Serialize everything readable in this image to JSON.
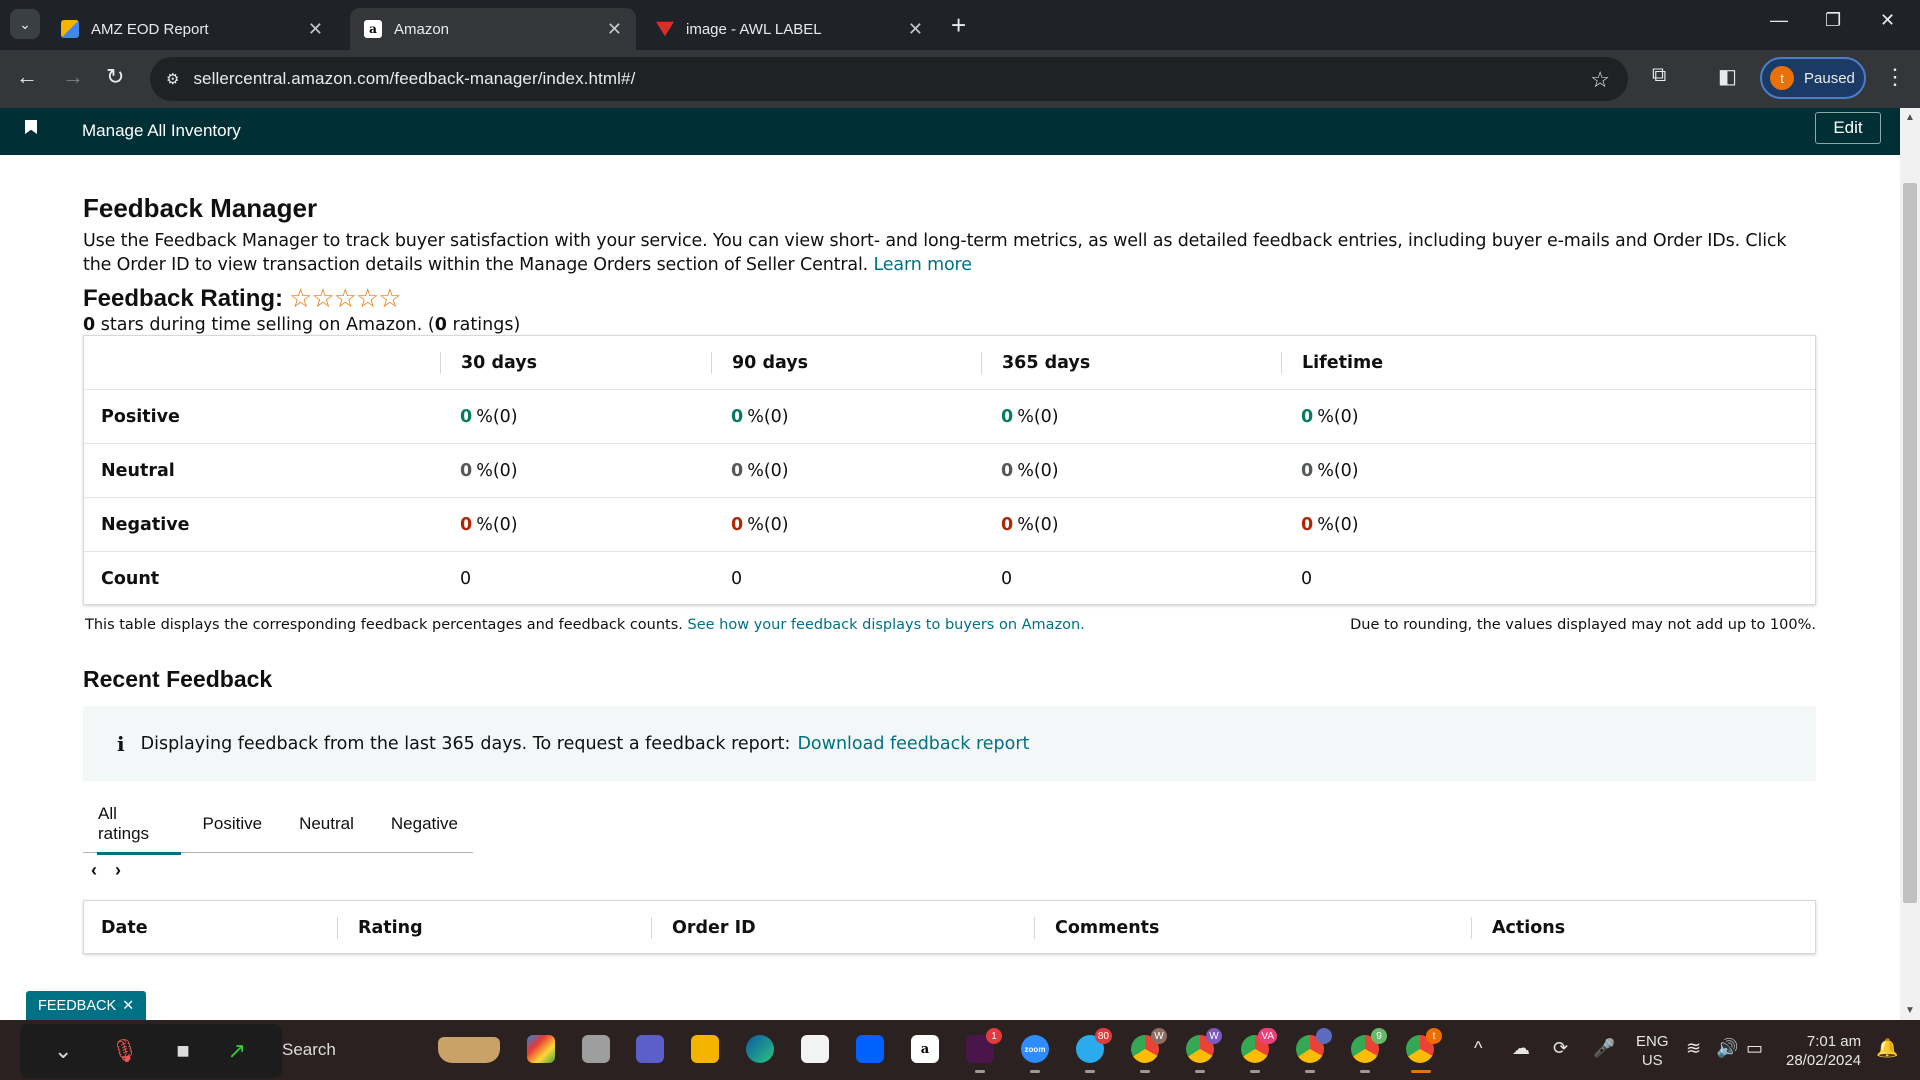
{
  "browser": {
    "tabs": [
      {
        "title": "AMZ EOD Report",
        "icon": "google-apps-script-icon",
        "active": false
      },
      {
        "title": "Amazon",
        "icon": "amazon-icon",
        "active": true
      },
      {
        "title": "image - AWL LABEL",
        "icon": "label-tag-icon",
        "active": false
      }
    ],
    "url": "sellercentral.amazon.com/feedback-manager/index.html#/",
    "profile_label": "Paused",
    "profile_initial": "t"
  },
  "seller_nav": {
    "bookmark_link": "Manage All Inventory",
    "edit_label": "Edit"
  },
  "page": {
    "title": "Feedback Manager",
    "description": "Use the Feedback Manager to track buyer satisfaction with your service. You can view short- and long-term metrics, as well as detailed feedback entries, including buyer e-mails and Order IDs. Click the Order ID to view transaction details within the Manage Orders section of Seller Central.",
    "learn_more": "Learn more",
    "rating_heading": "Feedback Rating:",
    "stars": "☆☆☆☆☆",
    "rating_stars_value": "0",
    "rating_sub_mid": " stars during time selling on Amazon. (",
    "rating_count_value": "0",
    "rating_sub_end": " ratings)"
  },
  "metrics": {
    "columns": [
      "30 days",
      "90 days",
      "365 days",
      "Lifetime"
    ],
    "rows": [
      {
        "label": "Positive",
        "values": [
          {
            "n": "0",
            "suffix": " %(0)"
          },
          {
            "n": "0",
            "suffix": " %(0)"
          },
          {
            "n": "0",
            "suffix": " %(0)"
          },
          {
            "n": "0",
            "suffix": " %(0)"
          }
        ]
      },
      {
        "label": "Neutral",
        "values": [
          {
            "n": "0",
            "suffix": " %(0)"
          },
          {
            "n": "0",
            "suffix": " %(0)"
          },
          {
            "n": "0",
            "suffix": " %(0)"
          },
          {
            "n": "0",
            "suffix": " %(0)"
          }
        ]
      },
      {
        "label": "Negative",
        "values": [
          {
            "n": "0",
            "suffix": " %(0)"
          },
          {
            "n": "0",
            "suffix": " %(0)"
          },
          {
            "n": "0",
            "suffix": " %(0)"
          },
          {
            "n": "0",
            "suffix": " %(0)"
          }
        ]
      },
      {
        "label": "Count",
        "values": [
          "0",
          "0",
          "0",
          "0"
        ]
      }
    ],
    "colors": {
      "positive": "#067d62",
      "neutral": "#565959",
      "negative": "#b12704"
    },
    "note": "This table displays the corresponding feedback percentages and feedback counts.",
    "note_link": "See how your feedback displays to buyers on Amazon.",
    "rounding_note": "Due to rounding, the values displayed may not add up to 100%."
  },
  "recent": {
    "title": "Recent Feedback",
    "info_icon": "i",
    "info_text": "Displaying feedback from the last 365 days. To request a feedback report:",
    "info_link": "Download feedback report",
    "filter_tabs": [
      "All ratings",
      "Positive",
      "Neutral",
      "Negative"
    ],
    "active_filter": "All ratings",
    "pager_prev": "‹",
    "pager_next": "›",
    "columns": [
      "Date",
      "Rating",
      "Order ID",
      "Comments",
      "Actions"
    ]
  },
  "feedback_pill": {
    "label": "FEEDBACK",
    "close": "✕"
  },
  "taskbar": {
    "search_placeholder": "Search",
    "lang": "ENG",
    "region": "US",
    "time": "7:01 am",
    "date": "28/02/2024",
    "badges": {
      "slack": "1",
      "telegram": "80",
      "chrome_w1": "W",
      "chrome_w2": "W",
      "chrome_va": "VA",
      "chrome_9": "9",
      "chrome_t": "t"
    }
  }
}
